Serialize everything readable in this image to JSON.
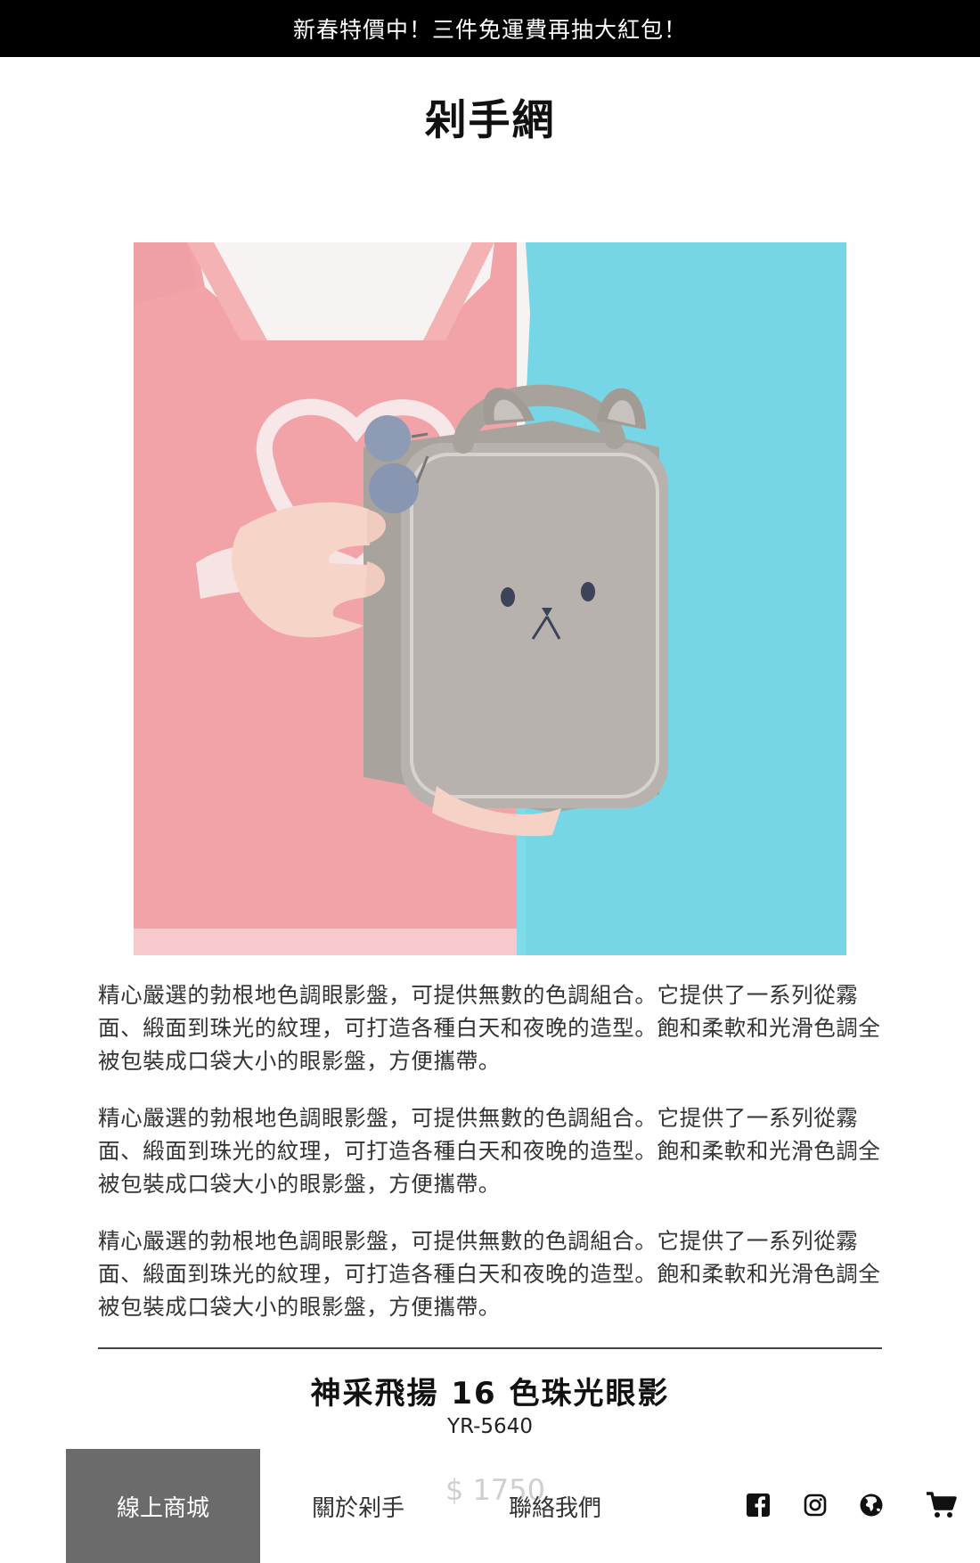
{
  "announcement": "新春特價中！三件免運費再抽大紅包！",
  "brand": "剁手網",
  "product_image": {
    "alt": "灰色兔子造型化妝包",
    "icon": "product-photo"
  },
  "description": [
    "精心嚴選的勃根地色調眼影盤，可提供無數的色調組合。它提供了一系列從霧面、緞面到珠光的紋理，可打造各種白天和夜晚的造型。飽和柔軟和光滑色調全被包裝成口袋大小的眼影盤，方便攜帶。",
    "精心嚴選的勃根地色調眼影盤，可提供無數的色調組合。它提供了一系列從霧面、緞面到珠光的紋理，可打造各種白天和夜晚的造型。飽和柔軟和光滑色調全被包裝成口袋大小的眼影盤，方便攜帶。",
    "精心嚴選的勃根地色調眼影盤，可提供無數的色調組合。它提供了一系列從霧面、緞面到珠光的紋理，可打造各種白天和夜晚的造型。飽和柔軟和光滑色調全被包裝成口袋大小的眼影盤，方便攜帶。"
  ],
  "product": {
    "name": "神采飛揚 16 色珠光眼影",
    "sku": "YR-5640",
    "price": "$ 1750"
  },
  "nav": {
    "shop": "線上商城",
    "about": "關於剁手",
    "contact": "聯絡我們",
    "active": "shop"
  },
  "icons": {
    "facebook": "facebook-icon",
    "instagram": "instagram-icon",
    "language": "globe-icon",
    "cart": "cart-icon"
  },
  "colors": {
    "announcement_bg": "#000000",
    "nav_active_bg": "#6b6b6b",
    "price_text": "#cfcfcf"
  }
}
